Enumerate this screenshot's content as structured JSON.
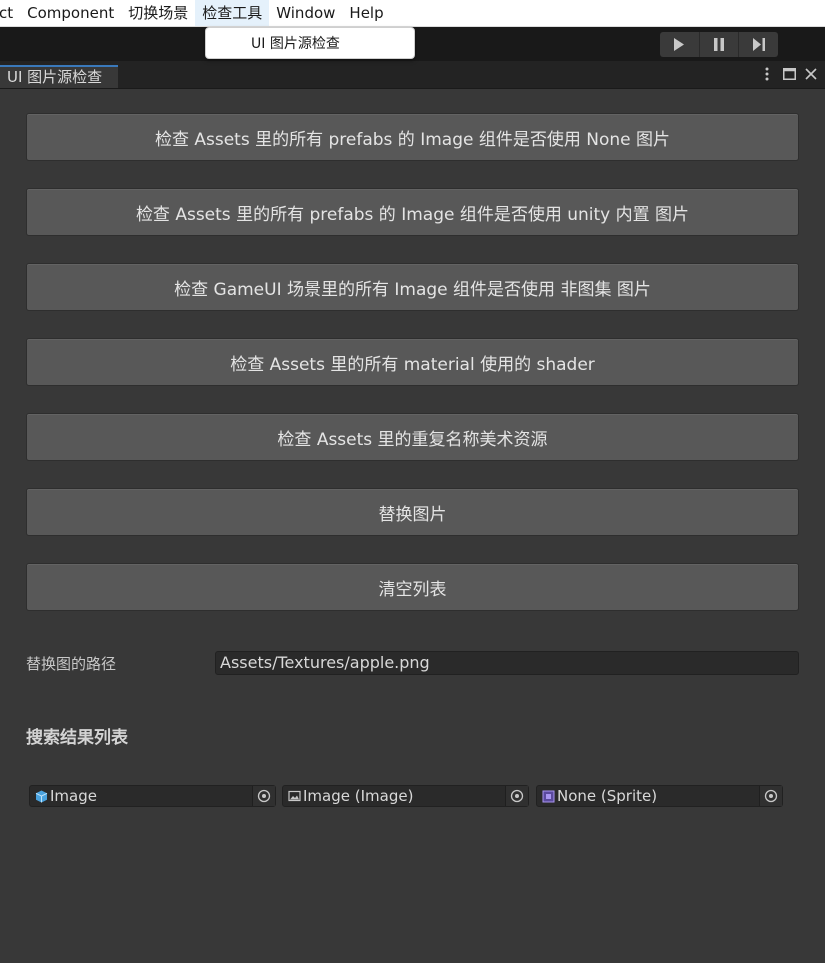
{
  "menubar": {
    "items": [
      "ct",
      "Component",
      "切换场景",
      "检查工具",
      "Window",
      "Help"
    ]
  },
  "dropdown": {
    "item": "UI 图片源检查"
  },
  "toolbar": {
    "icons": [
      "play-icon",
      "pause-icon",
      "step-icon"
    ]
  },
  "window": {
    "tab_title": "UI 图片源检查",
    "tab_icons": [
      "more-vert-icon",
      "maximize-icon",
      "close-icon"
    ]
  },
  "buttons": [
    "检查 Assets 里的所有 prefabs 的 Image 组件是否使用 None 图片",
    "检查 Assets 里的所有 prefabs 的 Image 组件是否使用 unity 内置 图片",
    "检查 GameUI 场景里的所有 Image 组件是否使用 非图集 图片",
    "检查 Assets 里的所有 material 使用的 shader",
    "检查 Assets 里的重复名称美术资源",
    "替换图片",
    "清空列表"
  ],
  "replace_path": {
    "label": "替换图的路径",
    "value": "Assets/Textures/apple.png"
  },
  "results": {
    "title": "搜索结果列表",
    "fields": [
      {
        "text": "Image",
        "icon": "gameobject-cube-icon"
      },
      {
        "text": "Image (Image)",
        "icon": "image-component-icon"
      },
      {
        "text": "None (Sprite)",
        "icon": "sprite-icon"
      }
    ]
  },
  "colors": {
    "tab_accent": "#3a79bb",
    "panel_bg": "#383838",
    "button_bg": "#585858"
  }
}
